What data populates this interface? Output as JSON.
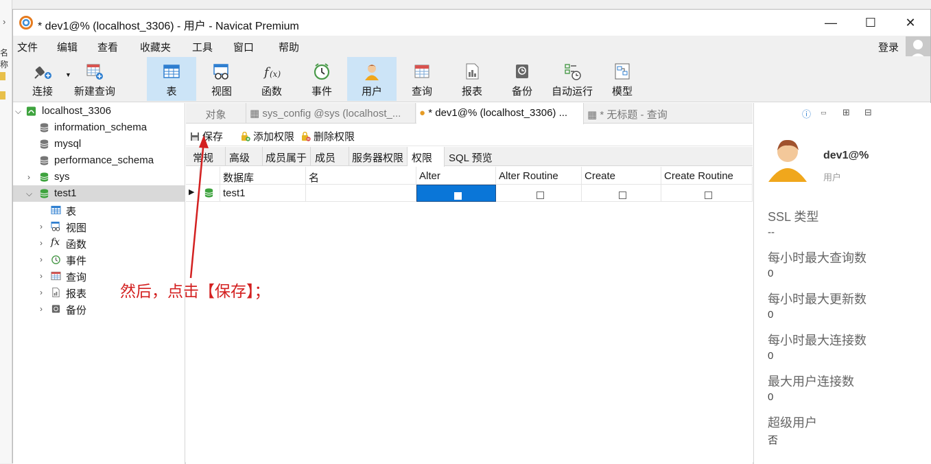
{
  "window": {
    "title": "* dev1@% (localhost_3306) - 用户 - Navicat Premium"
  },
  "desktop": {
    "fragment": "名称"
  },
  "menu": [
    "文件",
    "编辑",
    "查看",
    "收藏夹",
    "工具",
    "窗口",
    "帮助"
  ],
  "login_label": "登录",
  "toolbar": [
    {
      "label": "连接",
      "icon": "connect-icon"
    },
    {
      "label": "新建查询",
      "icon": "new-query-icon"
    },
    {
      "label": "表",
      "icon": "table-icon"
    },
    {
      "label": "视图",
      "icon": "view-icon"
    },
    {
      "label": "函数",
      "icon": "function-icon"
    },
    {
      "label": "事件",
      "icon": "event-clock-icon"
    },
    {
      "label": "用户",
      "icon": "user-icon"
    },
    {
      "label": "查询",
      "icon": "query-icon"
    },
    {
      "label": "报表",
      "icon": "report-icon"
    },
    {
      "label": "备份",
      "icon": "backup-icon"
    },
    {
      "label": "自动运行",
      "icon": "automation-icon"
    },
    {
      "label": "模型",
      "icon": "model-icon"
    }
  ],
  "tree": {
    "connection": "localhost_3306",
    "dbs": [
      "information_schema",
      "mysql",
      "performance_schema",
      "sys",
      "test1"
    ],
    "children": [
      "表",
      "视图",
      "函数",
      "事件",
      "查询",
      "报表",
      "备份"
    ],
    "func_glyph": "fx"
  },
  "tabs": [
    "对象",
    "sys_config @sys (localhost_...",
    "* dev1@% (localhost_3306) ...",
    "* 无标题 - 查询"
  ],
  "subtoolbar": {
    "save": "保存",
    "add": "添加权限",
    "delete": "删除权限"
  },
  "prop_tabs": [
    "常规",
    "高级",
    "成员属于",
    "成员",
    "服务器权限",
    "权限",
    "SQL 预览"
  ],
  "grid": {
    "columns": [
      "数据库",
      "名",
      "Alter",
      "Alter Routine",
      "Create",
      "Create Routine"
    ],
    "row": {
      "database": "test1",
      "name": ""
    }
  },
  "right_panel": {
    "user": "dev1@%",
    "role": "用户",
    "props": [
      {
        "label": "SSL 类型",
        "value": "--"
      },
      {
        "label": "每小时最大查询数",
        "value": "0"
      },
      {
        "label": "每小时最大更新数",
        "value": "0"
      },
      {
        "label": "每小时最大连接数",
        "value": "0"
      },
      {
        "label": "最大用户连接数",
        "value": "0"
      },
      {
        "label": "超级用户",
        "value": "否"
      }
    ]
  },
  "annotation": "然后，点击【保存】；",
  "colors": {
    "accent": "#0a76d8",
    "annotation": "#d32020",
    "active_tool": "#cce4f7"
  }
}
